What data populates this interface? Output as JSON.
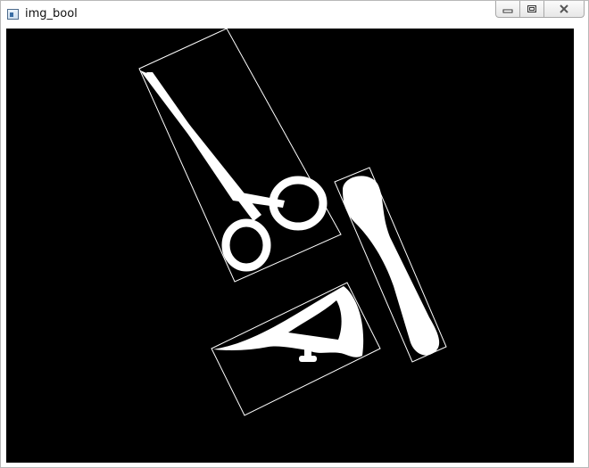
{
  "window": {
    "title": "img_bool",
    "app_icon": "window-app-icon",
    "buttons": [
      {
        "name": "minimize",
        "icon": "minimize-icon"
      },
      {
        "name": "restore",
        "icon": "restore-icon"
      },
      {
        "name": "close",
        "icon": "close-icon"
      }
    ]
  },
  "canvas": {
    "background": "#000000",
    "foreground": "#ffffff",
    "objects": [
      {
        "name": "scissors",
        "icon": "scissors-icon"
      },
      {
        "name": "bone",
        "icon": "bone-icon"
      },
      {
        "name": "protractor",
        "icon": "protractor-icon"
      }
    ]
  }
}
